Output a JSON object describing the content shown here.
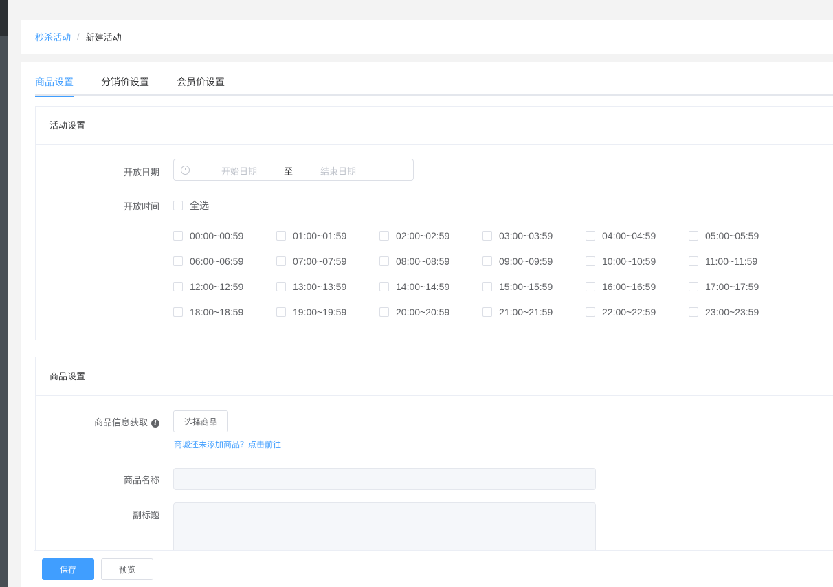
{
  "breadcrumb": {
    "parent": "秒杀活动",
    "separator": "/",
    "current": "新建活动"
  },
  "tabs": [
    {
      "label": "商品设置",
      "active": true
    },
    {
      "label": "分销价设置",
      "active": false
    },
    {
      "label": "会员价设置",
      "active": false
    }
  ],
  "activity_panel": {
    "title": "活动设置",
    "open_date_label": "开放日期",
    "start_placeholder": "开始日期",
    "range_separator": "至",
    "end_placeholder": "结束日期",
    "open_time_label": "开放时间",
    "select_all_label": "全选",
    "time_slots": [
      "00:00~00:59",
      "01:00~01:59",
      "02:00~02:59",
      "03:00~03:59",
      "04:00~04:59",
      "05:00~05:59",
      "06:00~06:59",
      "07:00~07:59",
      "08:00~08:59",
      "09:00~09:59",
      "10:00~10:59",
      "11:00~11:59",
      "12:00~12:59",
      "13:00~13:59",
      "14:00~14:59",
      "15:00~15:59",
      "16:00~16:59",
      "17:00~17:59",
      "18:00~18:59",
      "19:00~19:59",
      "20:00~20:59",
      "21:00~21:59",
      "22:00~22:59",
      "23:00~23:59"
    ]
  },
  "goods_panel": {
    "title": "商品设置",
    "info_label": "商品信息获取",
    "select_goods_button": "选择商品",
    "no_goods_hint": "商城还未添加商品？点击前往",
    "name_label": "商品名称",
    "subtitle_label": "副标题"
  },
  "footer": {
    "save_label": "保存",
    "preview_label": "预览"
  },
  "colors": {
    "accent": "#409eff",
    "sidebar": "#484f55"
  }
}
